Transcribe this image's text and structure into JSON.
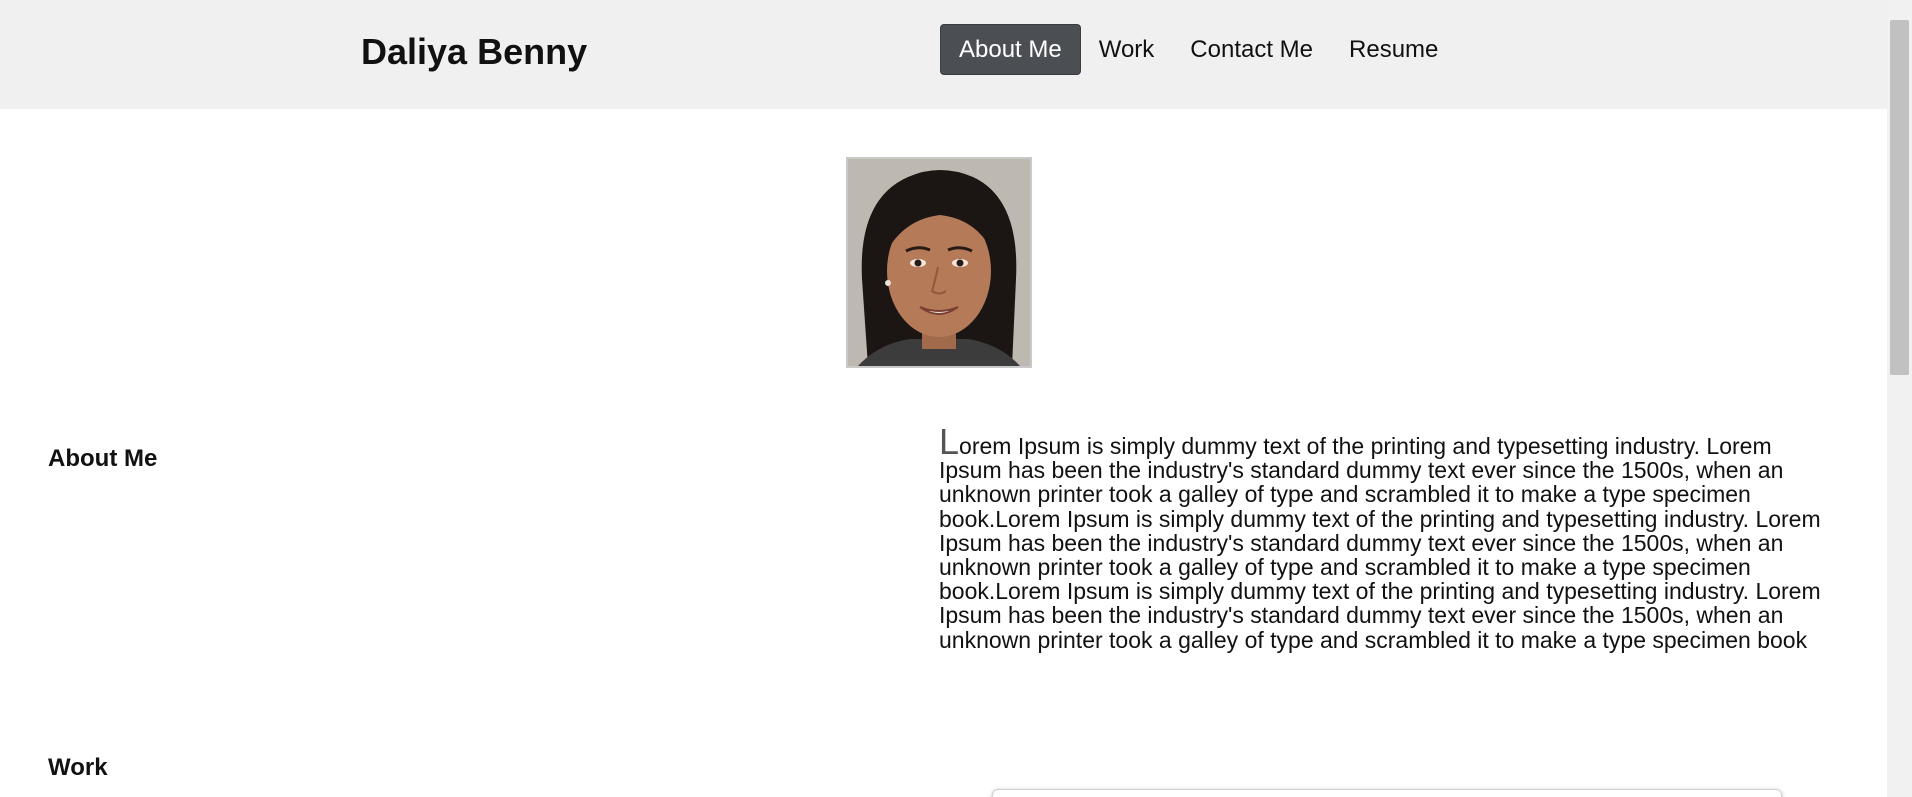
{
  "header": {
    "brand": "Daliya Benny",
    "nav": [
      {
        "label": "About Me",
        "active": true
      },
      {
        "label": "Work",
        "active": false
      },
      {
        "label": "Contact Me",
        "active": false
      },
      {
        "label": "Resume",
        "active": false
      }
    ]
  },
  "about": {
    "heading": "About Me",
    "drop_cap": "L",
    "body": "orem Ipsum is simply dummy text of the printing and typesetting industry. Lorem Ipsum has been the industry's standard dummy text ever since the 1500s, when an unknown printer took a galley of type and scrambled it to make a type specimen book.Lorem Ipsum is simply dummy text of the printing and typesetting industry. Lorem Ipsum has been the industry's standard dummy text ever since the 1500s, when an unknown printer took a galley of type and scrambled it to make a type specimen book.Lorem Ipsum is simply dummy text of the printing and typesetting industry. Lorem Ipsum has been the industry's standard dummy text ever since the 1500s, when an unknown printer took a galley of type and scrambled it to make a type specimen book"
  },
  "work": {
    "heading": "Work"
  },
  "colors": {
    "header_bg": "#f0f0f0",
    "nav_active_bg": "#4b4f54",
    "nav_active_text": "#ffffff",
    "text": "#111111"
  }
}
